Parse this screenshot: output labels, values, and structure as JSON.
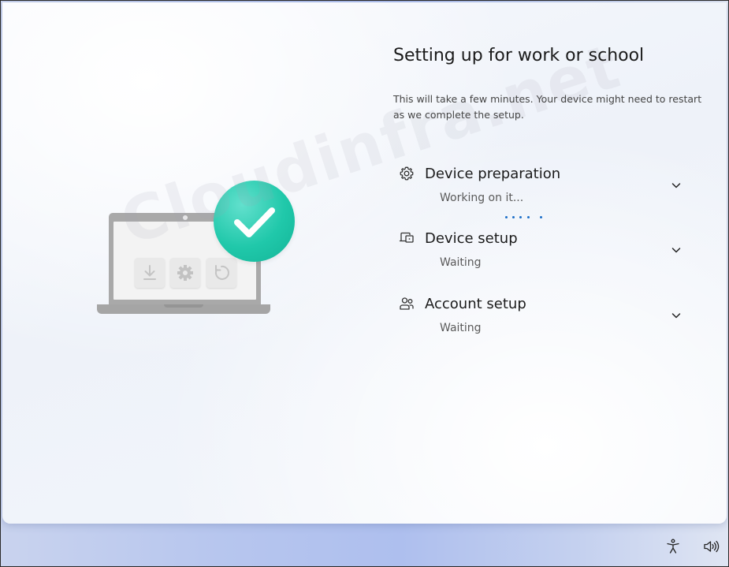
{
  "window": {
    "title": "Setting up for work or school",
    "subtitle": "This will take a few minutes. Your device might need to restart as we complete the setup."
  },
  "watermark": "Cloudinfra.net",
  "steps": [
    {
      "title": "Device preparation",
      "status": "Working on it...",
      "icon": "gear-icon",
      "expand_icon": "chevron-down-icon",
      "active": true
    },
    {
      "title": "Device setup",
      "status": "Waiting",
      "icon": "devices-icon",
      "expand_icon": "chevron-down-icon",
      "active": false
    },
    {
      "title": "Account setup",
      "status": "Waiting",
      "icon": "people-icon",
      "expand_icon": "chevron-down-icon",
      "active": false
    }
  ],
  "illustration": {
    "tiles": [
      "download-icon",
      "gear-icon",
      "refresh-icon"
    ],
    "badge": "checkmark-icon"
  },
  "colors": {
    "badge": "#20c8aa",
    "progress": "#1c6fc9",
    "laptop": "#a9a9a9"
  },
  "tray": {
    "icons": [
      "accessibility-icon",
      "volume-icon"
    ]
  }
}
